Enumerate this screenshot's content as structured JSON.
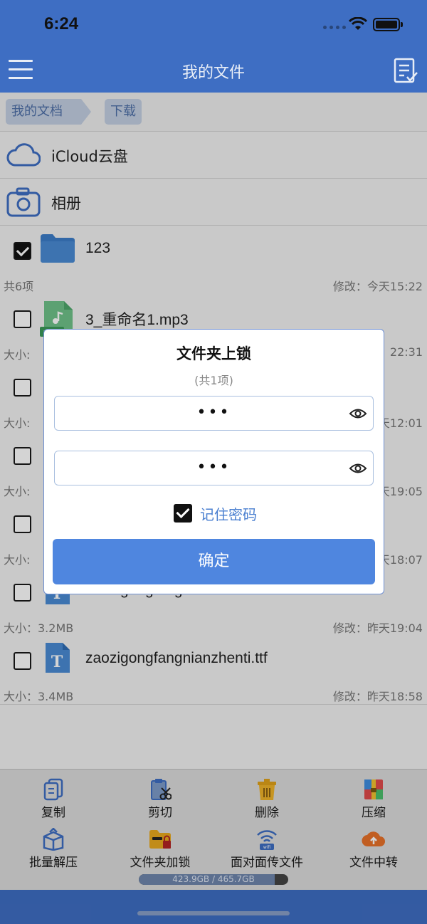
{
  "status": {
    "time": "6:24"
  },
  "nav": {
    "title": "我的文件",
    "menu_icon": "hamburger-menu-icon",
    "edit_icon": "edit-list-icon"
  },
  "breadcrumb": [
    "我的文档",
    "下载"
  ],
  "locations": [
    {
      "label": "iCloud云盘",
      "icon": "cloud-icon"
    },
    {
      "label": "相册",
      "icon": "camera-icon"
    }
  ],
  "files": [
    {
      "name": "123",
      "type": "folder",
      "checked": true,
      "meta_left": "共6项",
      "meta_right": "修改：今天15:22"
    },
    {
      "name": "3_重命名1.mp3",
      "type": "mp3",
      "checked": false,
      "meta_left": "大小:",
      "meta_right": "22:31"
    },
    {
      "name": "",
      "type": "hidden",
      "checked": false,
      "meta_left": "大小:",
      "meta_right": "天12:01"
    },
    {
      "name": "",
      "type": "hidden",
      "checked": false,
      "meta_left": "大小:",
      "meta_right": "天19:05"
    },
    {
      "name": "",
      "type": "hidden",
      "checked": false,
      "meta_left": "大小:",
      "meta_right": "天18:07"
    },
    {
      "name": "zaozigongfangnianzhenti.ttf",
      "type": "font",
      "checked": false,
      "meta_left": "大小：3.2MB",
      "meta_right": "修改：昨天19:04"
    },
    {
      "name": "zaozigongfangnianzhenti.ttf",
      "type": "font",
      "checked": false,
      "meta_left": "大小：3.4MB",
      "meta_right": "修改：昨天18:58"
    }
  ],
  "toolbar": {
    "items": [
      {
        "label": "复制",
        "icon": "copy-icon"
      },
      {
        "label": "剪切",
        "icon": "cut-icon"
      },
      {
        "label": "删除",
        "icon": "trash-icon"
      },
      {
        "label": "压缩",
        "icon": "compress-icon"
      },
      {
        "label": "批量解压",
        "icon": "extract-icon"
      },
      {
        "label": "文件夹加锁",
        "icon": "folder-lock-icon"
      },
      {
        "label": "面对面传文件",
        "icon": "wifi-transfer-icon"
      },
      {
        "label": "文件中转",
        "icon": "cloud-upload-icon"
      }
    ],
    "storage": {
      "text": "423.9GB / 465.7GB",
      "used_fraction": 0.91
    }
  },
  "dialog": {
    "title": "文件夹上锁",
    "subtitle": "(共1项)",
    "password1": "•••",
    "password2": "•••",
    "remember_label": "记住密码",
    "remember_checked": true,
    "confirm_label": "确定"
  },
  "colors": {
    "primary": "#3e6ec3",
    "button": "#4f86df",
    "link": "#4a7fd0"
  }
}
